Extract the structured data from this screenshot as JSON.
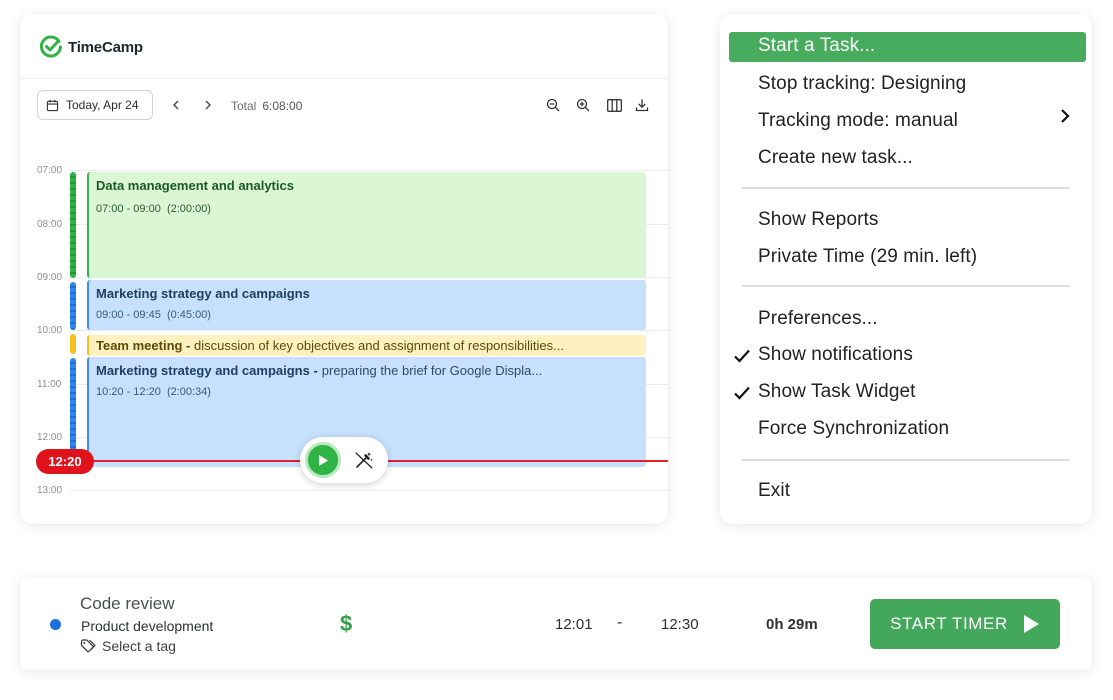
{
  "app": {
    "brand": "TimeCamp"
  },
  "calendar": {
    "date_label": "Today, Apr 24",
    "total_label": "Total",
    "total_value": "6:08:00",
    "hours": [
      "07:00",
      "08:00",
      "09:00",
      "10:00",
      "11:00",
      "12:00",
      "13:00"
    ],
    "now_label": "12:20",
    "events": [
      {
        "title": "Data management and analytics",
        "time": "07:00 - 09:00  (2:00:00)",
        "color": "#dbf6d4"
      },
      {
        "title": "Marketing strategy and campaigns",
        "time": "09:00 - 09:45  (0:45:00)",
        "color": "#c7e0fd"
      },
      {
        "title": "Team meeting -",
        "note": "discussion of key objectives and assignment of responsibilities...",
        "color": "#fdf1bf"
      },
      {
        "title": "Marketing strategy and campaigns -",
        "note": "preparing the brief for Google Displa...",
        "time": "10:20 - 12:20  (2:00:34)",
        "color": "#c7e0fd"
      }
    ]
  },
  "menu": {
    "items": [
      "Start a Task...",
      "Stop tracking: Designing",
      "Tracking mode: manual",
      "Create new task...",
      "Show Reports",
      "Private Time (29 min. left)",
      "Preferences...",
      "Show notifications",
      "Show Task Widget",
      "Force Synchronization",
      "Exit"
    ],
    "highlight_color": "#47ac5e"
  },
  "timer": {
    "task": "Code review",
    "project": "Product development",
    "tag_placeholder": "Select a tag",
    "billable_symbol": "$",
    "start": "12:01",
    "separator": "-",
    "end": "12:30",
    "duration": "0h 29m",
    "button_label": "START TIMER",
    "accent": "#43a85b"
  }
}
